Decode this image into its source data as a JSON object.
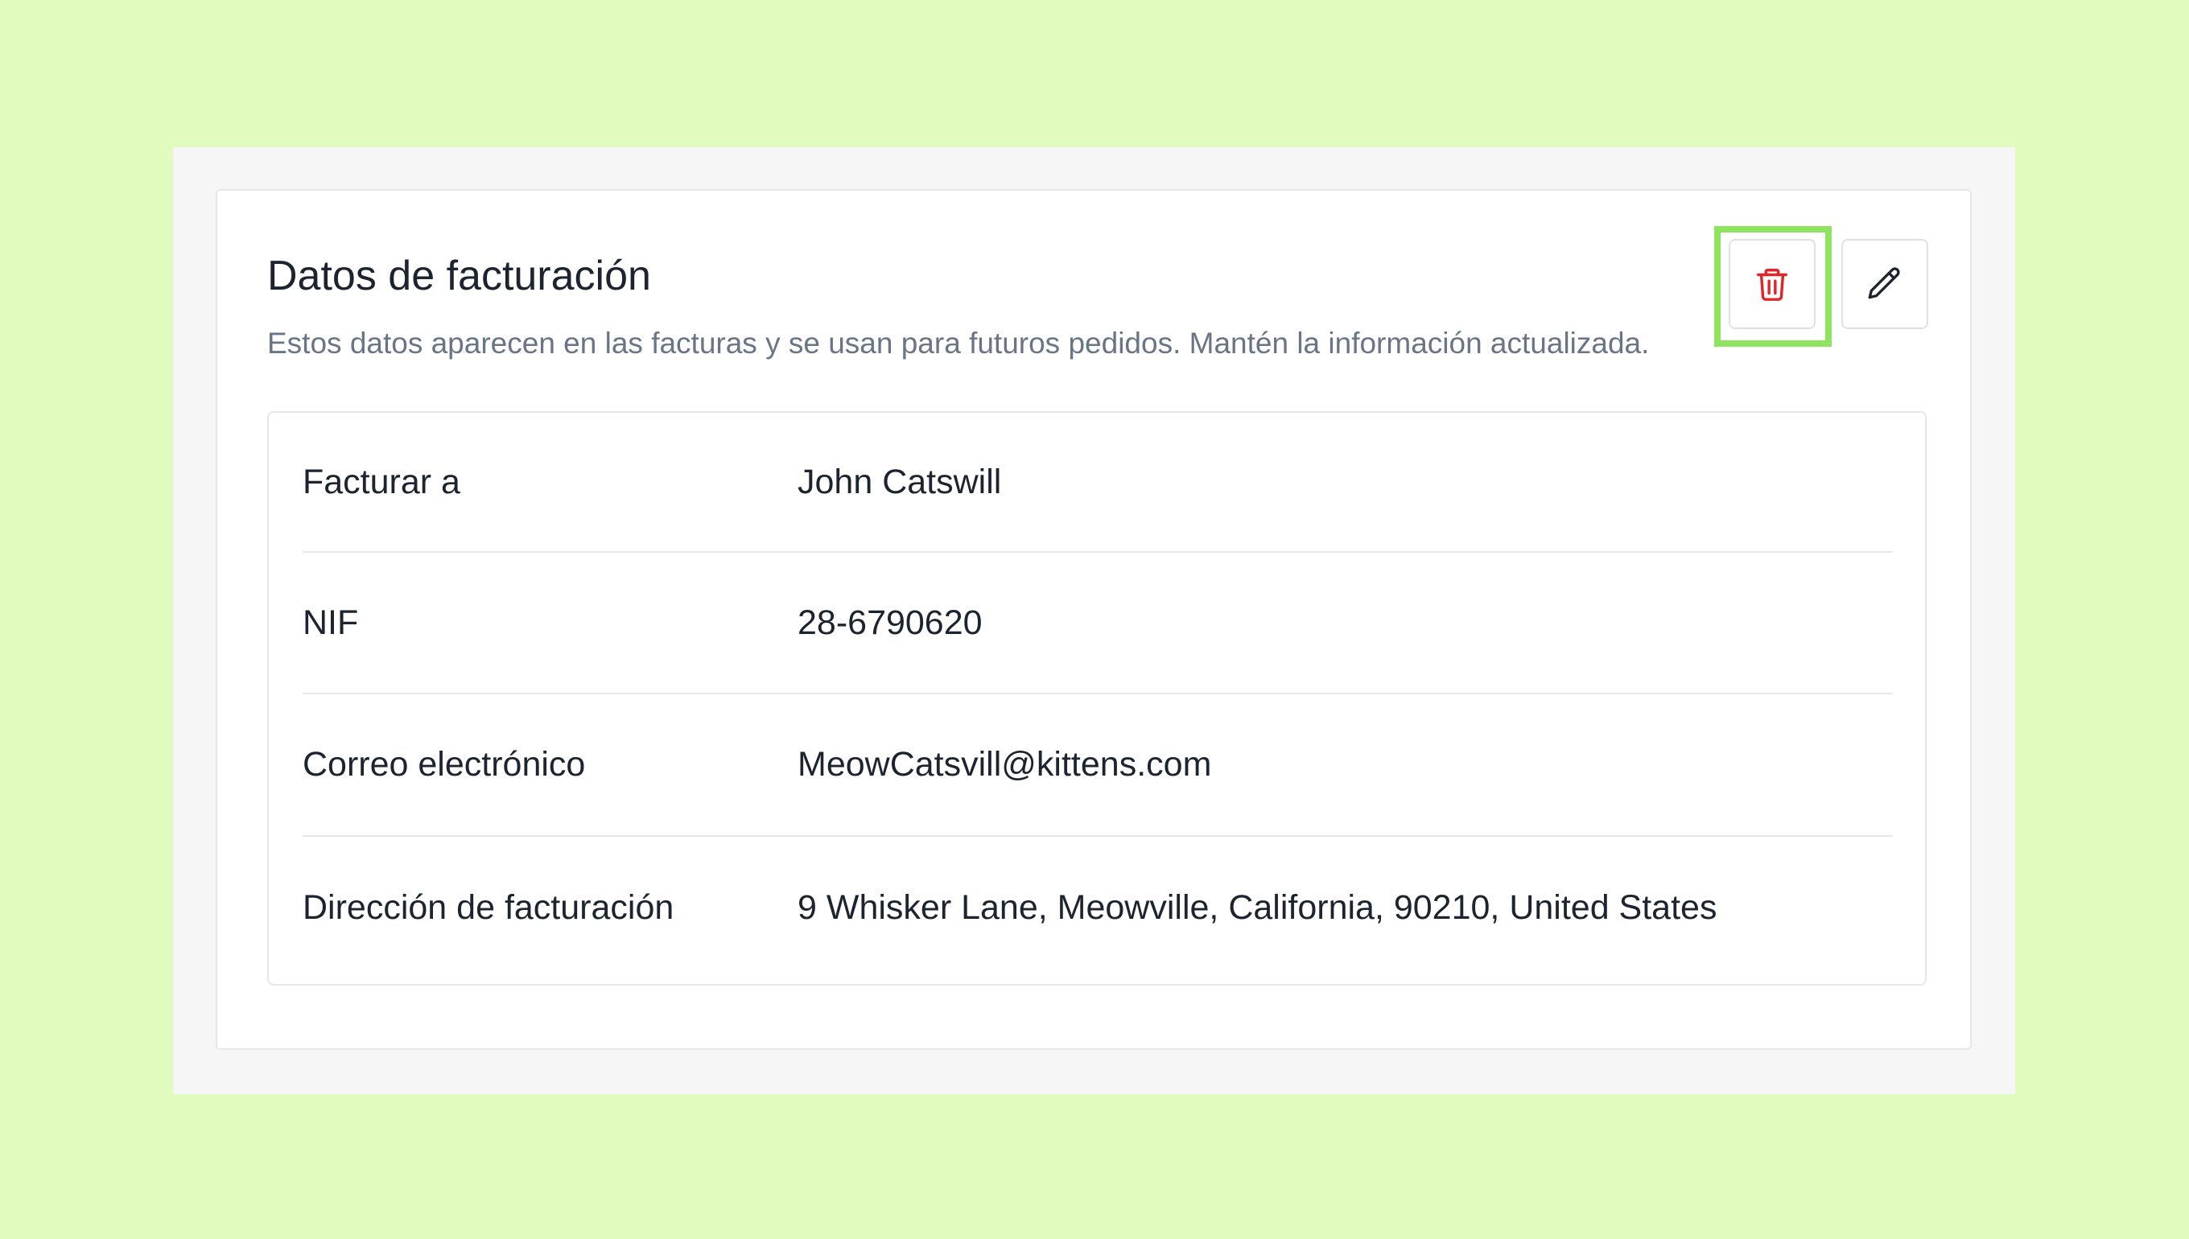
{
  "billing": {
    "title": "Datos de facturación",
    "description": "Estos datos aparecen en las facturas y se usan para futuros pedidos. Mantén la información actualizada.",
    "actions": {
      "delete_icon": "trash-icon",
      "edit_icon": "pencil-icon",
      "delete_color": "#e0252b",
      "highlight_color": "#8ee35f"
    },
    "rows": [
      {
        "label": "Facturar a",
        "value": "John Catswill"
      },
      {
        "label": "NIF",
        "value": "28-6790620"
      },
      {
        "label": "Correo electrónico",
        "value": "MeowCatsvill@kittens.com"
      },
      {
        "label": "Dirección de facturación",
        "value": "9 Whisker Lane, Meowville, California, 90210, United States"
      }
    ]
  }
}
